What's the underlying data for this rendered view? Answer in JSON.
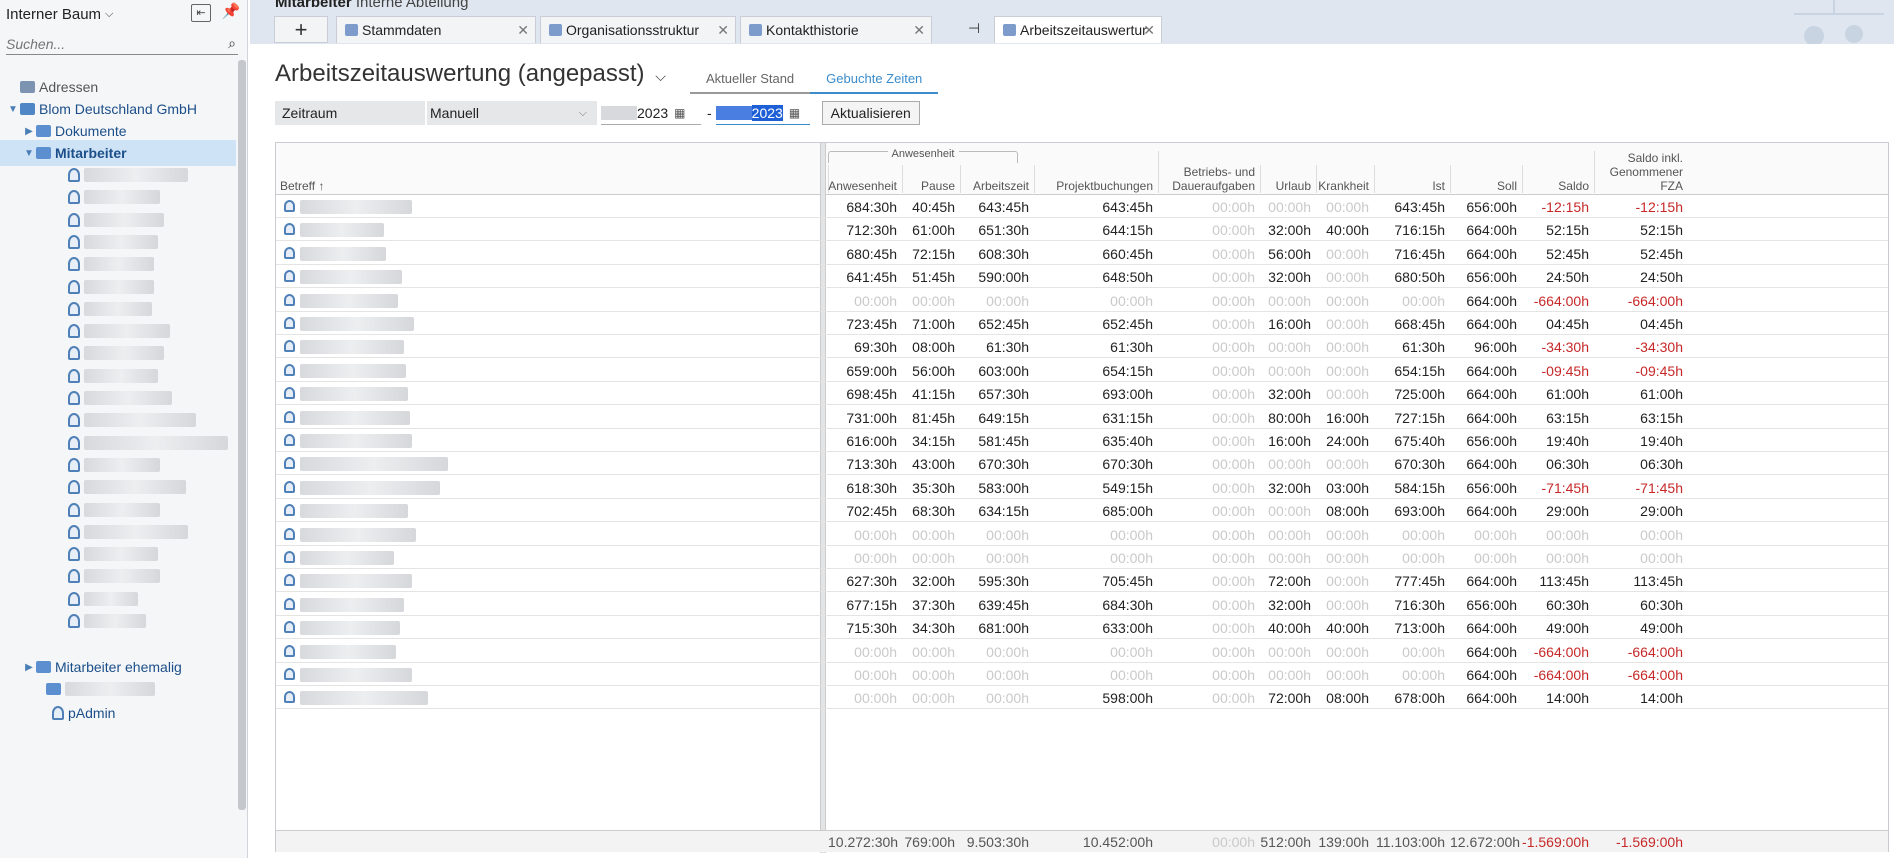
{
  "sidebar": {
    "title": "Interner Baum",
    "search_placeholder": "Suchen...",
    "tree": {
      "root": "Adressen",
      "company": "Blom Deutschland GmbH",
      "documents": "Dokumente",
      "employees": "Mitarbeiter",
      "former": "Mitarbeiter ehemalig",
      "admin": "pAdmin"
    }
  },
  "tabs": {
    "breadcrumb_bold": "Mitarbeiter",
    "breadcrumb_rest": "Interne Abteilung",
    "add": "+",
    "items": [
      "Stammdaten",
      "Organisationsstruktur",
      "Kontakthistorie",
      "Arbeitszeitauswertur"
    ]
  },
  "page": {
    "title": "Arbeitszeitauswertung (angepasst)",
    "views": [
      "Aktueller Stand",
      "Gebuchte Zeiten"
    ],
    "filter": {
      "label": "Zeitraum",
      "select": "Manuell",
      "date_from_year": "2023",
      "date_to_year": "2023",
      "dash": "-",
      "refresh": "Aktualisieren"
    }
  },
  "table": {
    "group_header": "Anwesenheit",
    "name_header": "Betreff ↑",
    "columns": [
      "Anwesenheit",
      "Pause",
      "Arbeitszeit",
      "Projektbuchungen",
      "Betriebs- und Daueraufgaben",
      "Urlaub",
      "Krankheit",
      "Ist",
      "Soll",
      "Saldo",
      "Saldo inkl. Genommener FZA"
    ],
    "rows": [
      [
        "684:30h",
        "40:45h",
        "643:45h",
        "643:45h",
        "00:00h",
        "00:00h",
        "00:00h",
        "643:45h",
        "656:00h",
        "-12:15h",
        "-12:15h"
      ],
      [
        "712:30h",
        "61:00h",
        "651:30h",
        "644:15h",
        "00:00h",
        "32:00h",
        "40:00h",
        "716:15h",
        "664:00h",
        "52:15h",
        "52:15h"
      ],
      [
        "680:45h",
        "72:15h",
        "608:30h",
        "660:45h",
        "00:00h",
        "56:00h",
        "00:00h",
        "716:45h",
        "664:00h",
        "52:45h",
        "52:45h"
      ],
      [
        "641:45h",
        "51:45h",
        "590:00h",
        "648:50h",
        "00:00h",
        "32:00h",
        "00:00h",
        "680:50h",
        "656:00h",
        "24:50h",
        "24:50h"
      ],
      [
        "00:00h",
        "00:00h",
        "00:00h",
        "00:00h",
        "00:00h",
        "00:00h",
        "00:00h",
        "00:00h",
        "664:00h",
        "-664:00h",
        "-664:00h"
      ],
      [
        "723:45h",
        "71:00h",
        "652:45h",
        "652:45h",
        "00:00h",
        "16:00h",
        "00:00h",
        "668:45h",
        "664:00h",
        "04:45h",
        "04:45h"
      ],
      [
        "69:30h",
        "08:00h",
        "61:30h",
        "61:30h",
        "00:00h",
        "00:00h",
        "00:00h",
        "61:30h",
        "96:00h",
        "-34:30h",
        "-34:30h"
      ],
      [
        "659:00h",
        "56:00h",
        "603:00h",
        "654:15h",
        "00:00h",
        "00:00h",
        "00:00h",
        "654:15h",
        "664:00h",
        "-09:45h",
        "-09:45h"
      ],
      [
        "698:45h",
        "41:15h",
        "657:30h",
        "693:00h",
        "00:00h",
        "32:00h",
        "00:00h",
        "725:00h",
        "664:00h",
        "61:00h",
        "61:00h"
      ],
      [
        "731:00h",
        "81:45h",
        "649:15h",
        "631:15h",
        "00:00h",
        "80:00h",
        "16:00h",
        "727:15h",
        "664:00h",
        "63:15h",
        "63:15h"
      ],
      [
        "616:00h",
        "34:15h",
        "581:45h",
        "635:40h",
        "00:00h",
        "16:00h",
        "24:00h",
        "675:40h",
        "656:00h",
        "19:40h",
        "19:40h"
      ],
      [
        "713:30h",
        "43:00h",
        "670:30h",
        "670:30h",
        "00:00h",
        "00:00h",
        "00:00h",
        "670:30h",
        "664:00h",
        "06:30h",
        "06:30h"
      ],
      [
        "618:30h",
        "35:30h",
        "583:00h",
        "549:15h",
        "00:00h",
        "32:00h",
        "03:00h",
        "584:15h",
        "656:00h",
        "-71:45h",
        "-71:45h"
      ],
      [
        "702:45h",
        "68:30h",
        "634:15h",
        "685:00h",
        "00:00h",
        "00:00h",
        "08:00h",
        "693:00h",
        "664:00h",
        "29:00h",
        "29:00h"
      ],
      [
        "00:00h",
        "00:00h",
        "00:00h",
        "00:00h",
        "00:00h",
        "00:00h",
        "00:00h",
        "00:00h",
        "00:00h",
        "00:00h",
        "00:00h"
      ],
      [
        "00:00h",
        "00:00h",
        "00:00h",
        "00:00h",
        "00:00h",
        "00:00h",
        "00:00h",
        "00:00h",
        "00:00h",
        "00:00h",
        "00:00h"
      ],
      [
        "627:30h",
        "32:00h",
        "595:30h",
        "705:45h",
        "00:00h",
        "72:00h",
        "00:00h",
        "777:45h",
        "664:00h",
        "113:45h",
        "113:45h"
      ],
      [
        "677:15h",
        "37:30h",
        "639:45h",
        "684:30h",
        "00:00h",
        "32:00h",
        "00:00h",
        "716:30h",
        "656:00h",
        "60:30h",
        "60:30h"
      ],
      [
        "715:30h",
        "34:30h",
        "681:00h",
        "633:00h",
        "00:00h",
        "40:00h",
        "40:00h",
        "713:00h",
        "664:00h",
        "49:00h",
        "49:00h"
      ],
      [
        "00:00h",
        "00:00h",
        "00:00h",
        "00:00h",
        "00:00h",
        "00:00h",
        "00:00h",
        "00:00h",
        "664:00h",
        "-664:00h",
        "-664:00h"
      ],
      [
        "00:00h",
        "00:00h",
        "00:00h",
        "00:00h",
        "00:00h",
        "00:00h",
        "00:00h",
        "00:00h",
        "664:00h",
        "-664:00h",
        "-664:00h"
      ],
      [
        "00:00h",
        "00:00h",
        "00:00h",
        "598:00h",
        "00:00h",
        "72:00h",
        "08:00h",
        "678:00h",
        "664:00h",
        "14:00h",
        "14:00h"
      ]
    ],
    "totals": [
      "10.272:30h",
      "769:00h",
      "9.503:30h",
      "10.452:00h",
      "00:00h",
      "512:00h",
      "139:00h",
      "11.103:00h",
      "12.672:00h",
      "-1.569:00h",
      "-1.569:00h"
    ]
  },
  "colors": {
    "accent": "#3b8ccb",
    "negative": "#c62828",
    "selection": "#cfe3f6"
  }
}
